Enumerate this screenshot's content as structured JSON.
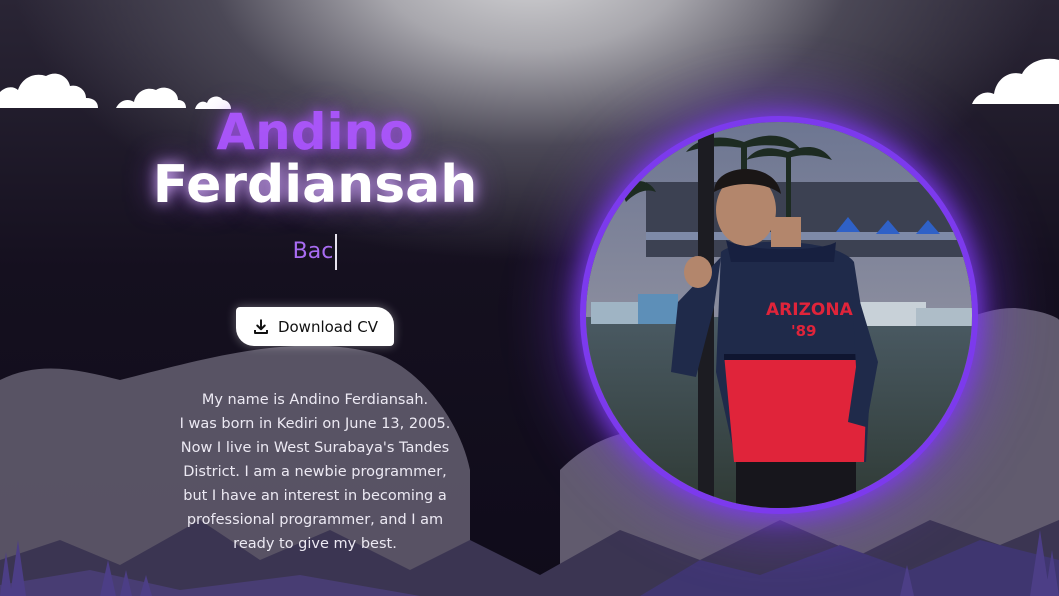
{
  "hero": {
    "first_name": "Andino",
    "last_name": "Ferdiansah",
    "typed_text": "Bac"
  },
  "download_button": {
    "label": "Download CV",
    "icon": "download-icon"
  },
  "bio": {
    "lines": [
      "My name is Andino Ferdiansah.",
      "I was born in Kediri on June 13, 2005.",
      "Now I live in West Surabaya's Tandes",
      "District. I am a newbie programmer,",
      "but I have an interest in becoming a",
      "professional programmer, and I am",
      "ready to give my best."
    ]
  },
  "avatar": {
    "shirt_text_1": "ARIZONA",
    "shirt_text_2": "'89"
  },
  "colors": {
    "accent_purple": "#a855f7",
    "glow_purple": "#7c3aed",
    "hill_gray": "#5f5a6b",
    "hill_dark": "#3a3452",
    "hoodie_navy": "#1f2a4a",
    "hoodie_red": "#e0243a"
  }
}
